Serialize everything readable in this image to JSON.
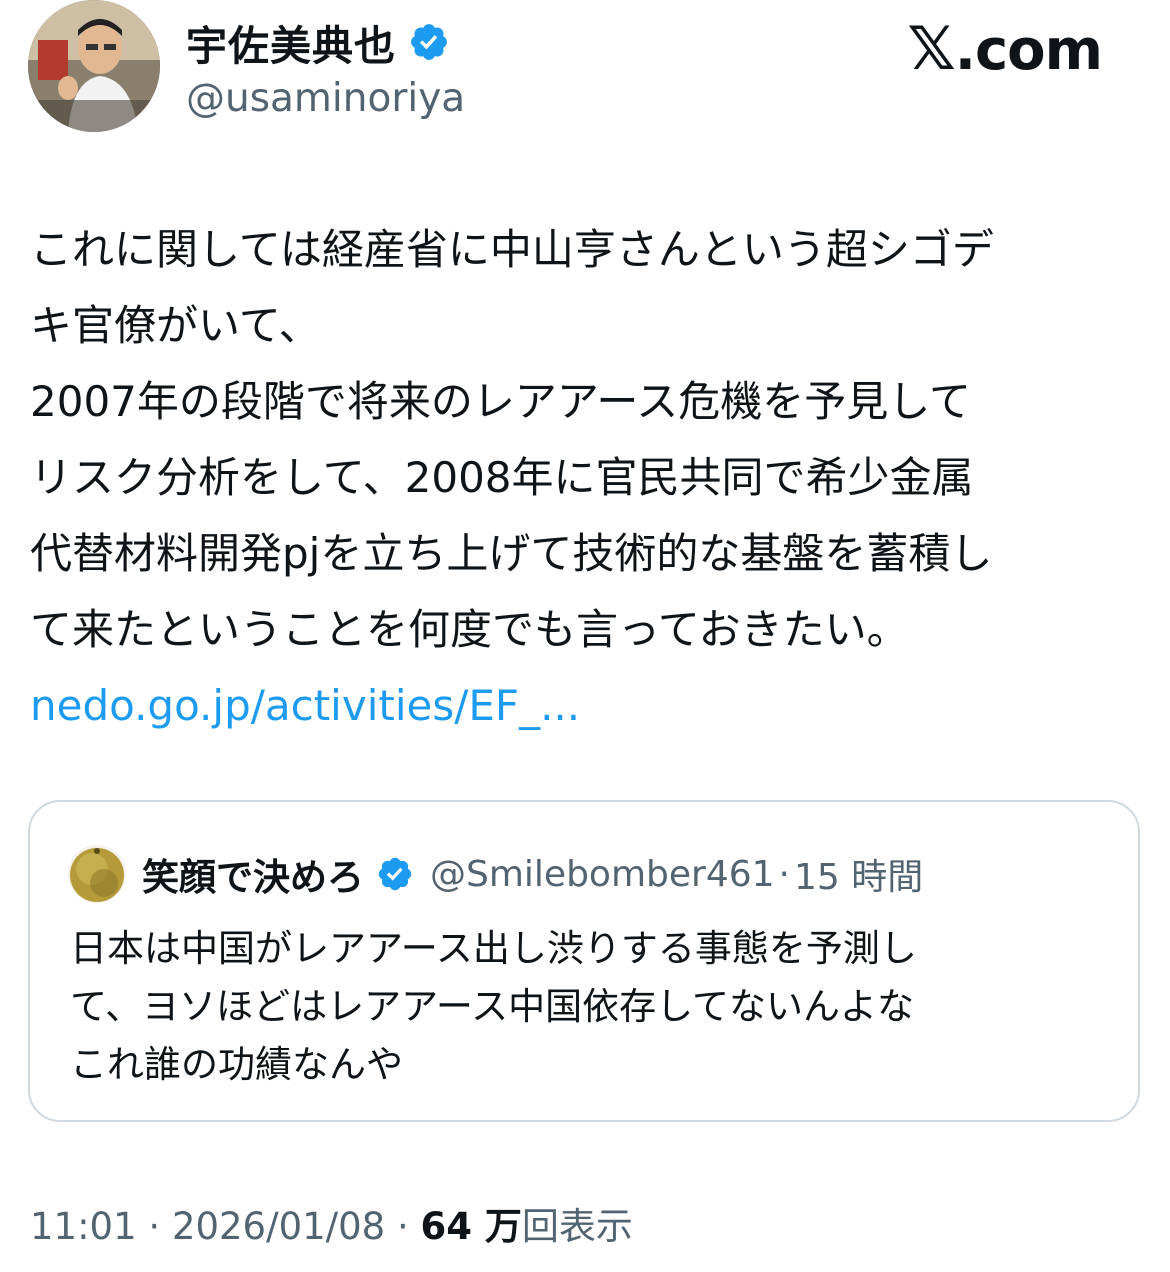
{
  "author": {
    "display_name": "宇佐美典也",
    "handle": "@usaminoriya",
    "verified_icon": "verified-badge-icon"
  },
  "brand": {
    "x_mark": "𝕏",
    "suffix": ".com"
  },
  "tweet": {
    "lines": [
      "これに関しては経産省に中山亨さんという超シゴデ",
      "キ官僚がいて、",
      "2007年の段階で将来のレアアース危機を予見して",
      "リスク分析をして、2008年に官民共同で希少金属",
      "代替材料開発pjを立ち上げて技術的な基盤を蓄積し",
      "て来たということを何度でも言っておきたい。"
    ],
    "link": "nedo.go.jp/activities/EF_..."
  },
  "quote": {
    "display_name": "笑顔で決めろ",
    "handle": "@Smilebomber461",
    "separator": "·",
    "time": "15 時間",
    "lines": [
      "日本は中国がレアアース出し渋りする事態を予測し",
      "て、ヨソほどはレアアース中国依存してないんよな",
      "これ誰の功績なんや"
    ]
  },
  "footer": {
    "time": "11:01",
    "sep1": " · ",
    "date": "2026/01/08",
    "sep2": " · ",
    "views_count": "64 万",
    "views_label": "回表示"
  },
  "colors": {
    "link": "#1d9bf0",
    "verified": "#1d9bf0",
    "secondary": "#536471",
    "border": "#cfd9de"
  }
}
